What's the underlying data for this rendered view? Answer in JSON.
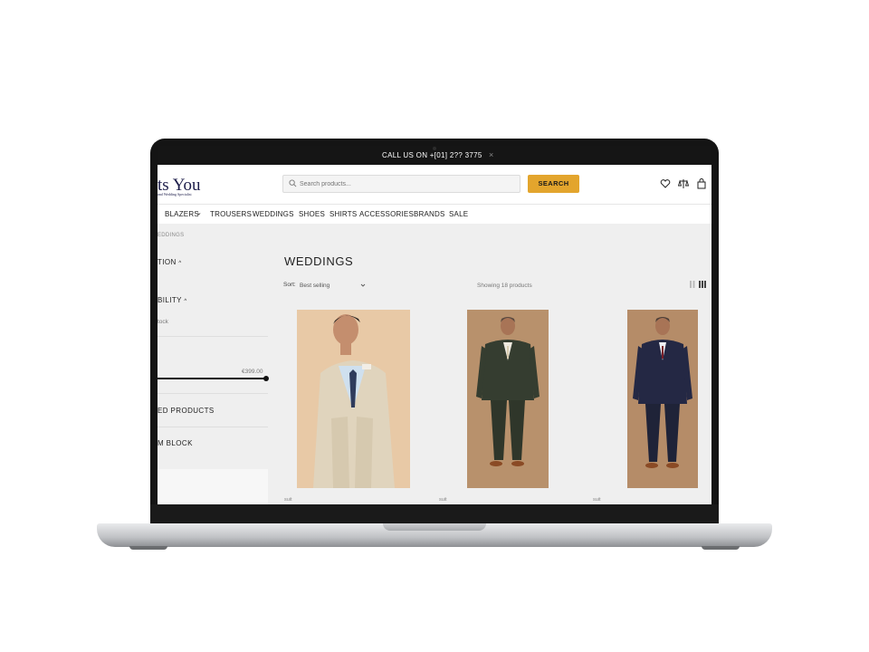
{
  "topbar": {
    "message": "CALL US ON +[01] 2?? 3775",
    "close": "×"
  },
  "header": {
    "logo_text": "ts You",
    "logo_sub": "and Wedding Specialist",
    "search_placeholder": "Search products...",
    "search_button": "SEARCH"
  },
  "nav": {
    "items": [
      "BLAZERS",
      "TROUSERS",
      "WEDDINGS",
      "SHOES",
      "SHIRTS",
      "ACCESSORIES",
      "BRANDS",
      "SALE"
    ],
    "blazers_chevron": "⌄"
  },
  "breadcrumb": "EDDINGS",
  "sidebar": {
    "collection_heading": "TION",
    "availability_heading": "BILITY",
    "stock_text": "tock",
    "max_price": "€399.00",
    "featured_heading": "ED PRODUCTS",
    "custom_heading": "M BLOCK"
  },
  "main": {
    "title": "WEDDINGS",
    "sort_label": "Sort:",
    "sort_value": "Best selling",
    "count_text": "Showing 18 products"
  },
  "products": [
    {
      "category": "suit",
      "suit_color": "#e0d4bd",
      "bg_color": "#e8c9a6",
      "tie_color": "#2f3b5c"
    },
    {
      "category": "suit",
      "suit_color": "#353d30",
      "bg_color": "#b8916c",
      "tie_color": "#d8ccb0"
    },
    {
      "category": "suit",
      "suit_color": "#242844",
      "bg_color": "#b58c68",
      "tie_color": "#7a1f2a"
    }
  ]
}
